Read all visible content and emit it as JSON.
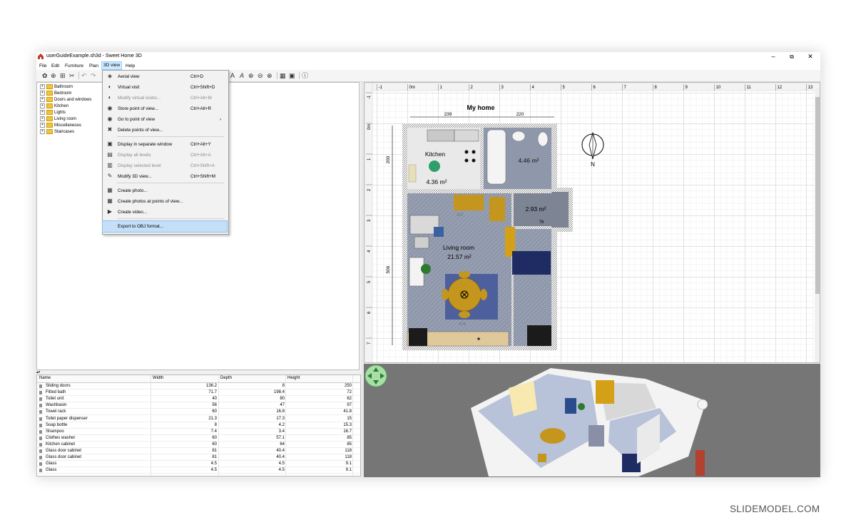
{
  "window": {
    "title": "userGuideExample.sh3d - Sweet Home 3D",
    "controls": {
      "minimize": "–",
      "maximize": "⧉",
      "close": "✕"
    }
  },
  "menubar": [
    "File",
    "Edit",
    "Furniture",
    "Plan",
    "3D view",
    "Help"
  ],
  "dropdown": {
    "items": [
      {
        "label": "Aerial view",
        "shortcut": "Ctrl+D",
        "icon": "◈",
        "disabled": false
      },
      {
        "label": "Virtual visit",
        "shortcut": "Ctrl+Shift+D",
        "icon": "◐",
        "disabled": false
      },
      {
        "label": "Modify virtual visitor...",
        "shortcut": "Ctrl+Alt+M",
        "icon": "◐",
        "disabled": true
      },
      {
        "label": "Store point of view...",
        "shortcut": "Ctrl+Alt+R",
        "icon": "◉",
        "disabled": false
      },
      {
        "label": "Go to point of view",
        "shortcut": "",
        "icon": "◉",
        "disabled": false,
        "submenu": "›"
      },
      {
        "label": "Delete points of view...",
        "shortcut": "",
        "icon": "✖",
        "disabled": false
      },
      {
        "label": "Display in separate window",
        "shortcut": "Ctrl+Alt+Y",
        "icon": "▣",
        "disabled": false
      },
      {
        "label": "Display all levels",
        "shortcut": "Ctrl+Alt+A",
        "icon": "▤",
        "disabled": true
      },
      {
        "label": "Display selected level",
        "shortcut": "Ctrl+Shift+A",
        "icon": "▥",
        "disabled": true
      },
      {
        "label": "Modify 3D view...",
        "shortcut": "Ctrl+Shift+M",
        "icon": "✎",
        "disabled": false
      },
      {
        "label": "Create photo...",
        "shortcut": "",
        "icon": "▦",
        "disabled": false
      },
      {
        "label": "Create photos at points of view...",
        "shortcut": "",
        "icon": "▦",
        "disabled": false
      },
      {
        "label": "Create video...",
        "shortcut": "",
        "icon": "▶",
        "disabled": false
      },
      {
        "label": "Export to OBJ format...",
        "shortcut": "",
        "icon": "",
        "disabled": false,
        "highlighted": true
      }
    ]
  },
  "catalog": [
    "Bathroom",
    "Bedroom",
    "Doors and windows",
    "Kitchen",
    "Lights",
    "Living room",
    "Miscellaneous",
    "Staircases"
  ],
  "furniture_table": {
    "columns": [
      "Name",
      "Width",
      "Depth",
      "Height"
    ],
    "rows": [
      [
        "Sliding doors",
        "136.2",
        "8",
        "250"
      ],
      [
        "Fitted bath",
        "71.7",
        "198.4",
        "72"
      ],
      [
        "Toilet unit",
        "40",
        "80",
        "62"
      ],
      [
        "Washbasin",
        "56",
        "47",
        "97"
      ],
      [
        "Towel rack",
        "60",
        "16.8",
        "41.8"
      ],
      [
        "Toilet paper dispenser",
        "21.3",
        "17.3",
        "15"
      ],
      [
        "Soap bottle",
        "8",
        "4.2",
        "15.3"
      ],
      [
        "Shampoo",
        "7.4",
        "3.4",
        "16.7"
      ],
      [
        "Clothes washer",
        "60",
        "57.1",
        "85"
      ],
      [
        "Kitchen cabinet",
        "60",
        "64",
        "85"
      ],
      [
        "Glass door cabinet",
        "81",
        "40.4",
        "118"
      ],
      [
        "Glass door cabinet",
        "81",
        "40.4",
        "118"
      ],
      [
        "Glass",
        "4.5",
        "4.5",
        "9.1"
      ],
      [
        "Glass",
        "4.5",
        "4.5",
        "9.1"
      ]
    ]
  },
  "plan": {
    "ruler_x": [
      "-1",
      "0m",
      "1",
      "2",
      "3",
      "4",
      "5",
      "6",
      "7",
      "8",
      "9",
      "10",
      "11",
      "12",
      "13"
    ],
    "ruler_y": [
      "-1",
      "0m",
      "1",
      "2",
      "3",
      "4",
      "5",
      "6",
      "7"
    ],
    "title": "My home",
    "dimensions": {
      "top_left": "239",
      "top_right": "220",
      "left_upper": "200",
      "left_lower": "506",
      "inner_top": "337",
      "inner_bottom": "474",
      "inner_right": "76"
    },
    "rooms": [
      {
        "name": "Kitchen",
        "area": "4.36 m²"
      },
      {
        "name": "",
        "area": "4.46 m²"
      },
      {
        "name": "",
        "area": "2.93 m²"
      },
      {
        "name": "Living room",
        "area": "21.57 m²"
      }
    ],
    "compass_label": "N"
  },
  "watermark": "SLIDEMODEL.COM"
}
